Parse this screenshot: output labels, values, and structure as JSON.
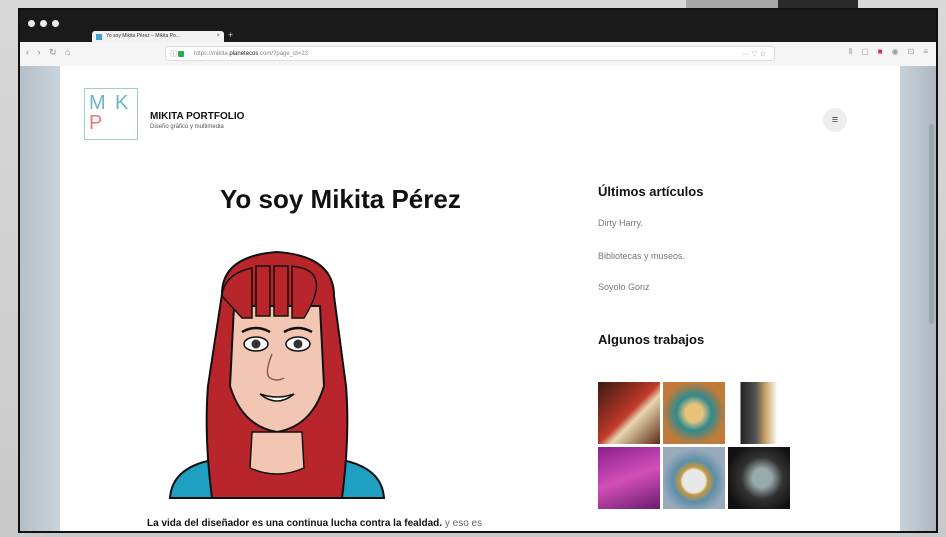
{
  "browser": {
    "tab_title": "Yo soy Mikita Pérez – Mikita Po...",
    "tab_close": "×",
    "new_tab": "+",
    "nav_buttons": "‹ › ↻ ⌂",
    "url_prefix": "https://mikita.",
    "url_domain": "planetecos",
    "url_suffix": ".com/?page_id=23",
    "url_actions": "··· ♡ ☆",
    "toolbar_icons": [
      "⫴",
      "▢",
      "■",
      "◉",
      "⊡",
      "≡"
    ]
  },
  "site": {
    "logo_m": "M",
    "logo_k": "K",
    "logo_p": "P",
    "title": "MIKITA PORTFOLIO",
    "tagline": "Diseño gráfico y multimedia",
    "menu_icon": "≡"
  },
  "main": {
    "heading": "Yo soy Mikita Pérez",
    "intro_bold": "La vida del diseñador es una continua lucha contra la fealdad.",
    "intro_rest": " y eso es"
  },
  "sidebar": {
    "articles_heading": "Últimos artículos",
    "articles": [
      "Dirty Harry.",
      "Bibliotecas y museos.",
      "Soyolo Gonz"
    ],
    "works_heading": "Algunos trabajos"
  },
  "colors": {
    "logo_teal": "#6fb4c2",
    "logo_pink": "#e27b7b",
    "hair": "#b8262b",
    "shirt": "#1fa0c2"
  },
  "icons": [
    "menu-icon",
    "lock-icon",
    "star-icon",
    "reload-icon",
    "home-icon"
  ]
}
